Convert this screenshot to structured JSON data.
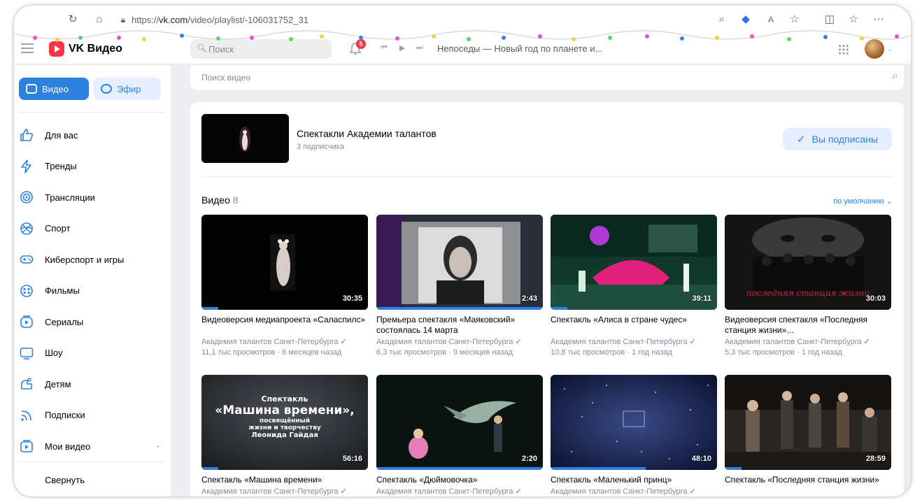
{
  "browser": {
    "url_prefix": "https://",
    "url_domain": "vk.com",
    "url_path": "/video/playlist/-106031752_31"
  },
  "header": {
    "logo": "VK Видео",
    "search_placeholder": "Поиск",
    "notifications_count": "5",
    "now_playing": "Непоседы — Новый год по планете и..."
  },
  "sidebar": {
    "tab_video": "Видео",
    "tab_efir": "Эфир",
    "items": [
      {
        "label": "Для вас",
        "icon": "thumbs-up-icon"
      },
      {
        "label": "Тренды",
        "icon": "lightning-icon"
      },
      {
        "label": "Трансляции",
        "icon": "broadcast-icon"
      },
      {
        "label": "Спорт",
        "icon": "ball-icon"
      },
      {
        "label": "Киберспорт и игры",
        "icon": "gamepad-icon"
      },
      {
        "label": "Фильмы",
        "icon": "film-reel-icon"
      },
      {
        "label": "Сериалы",
        "icon": "series-icon"
      },
      {
        "label": "Шоу",
        "icon": "tv-icon"
      },
      {
        "label": "Детям",
        "icon": "kids-icon"
      },
      {
        "label": "Подписки",
        "icon": "rss-icon"
      },
      {
        "label": "Мои видео",
        "icon": "my-video-icon"
      }
    ],
    "collapse": "Свернуть"
  },
  "main": {
    "video_search_placeholder": "Поиск видео",
    "playlist": {
      "title": "Спектакли Академии талантов",
      "subscribers": "3 подписчика",
      "subscribed_label": "Вы подписаны"
    },
    "section_title": "Видео",
    "section_count": "8",
    "sort_label": "по умолчанию",
    "videos": [
      {
        "title": "Видеоверсия медиапроекта «Саласпилс»",
        "author": "Академия талантов Санкт-Петербурга",
        "meta": "11,1 тыс просмотров · 6 месяцев назад",
        "duration": "30:35",
        "progress": 0.1
      },
      {
        "title": "Премьера спектакля «Маяковский» состоялась 14 марта",
        "author": "Академия талантов Санкт-Петербурга",
        "meta": "6,3 тыс просмотров · 9 месяцев назад",
        "duration": "2:43",
        "progress": 1.0
      },
      {
        "title": "Спектакль «Алиса в стране чудес»",
        "author": "Академия талантов Санкт-Петербурга",
        "meta": "10,8 тыс просмотров · 1 год назад",
        "duration": "39:11",
        "progress": 0.1
      },
      {
        "title": "Видеоверсия спектакля «Последняя станция жизни»...",
        "author": "Академия талантов Санкт-Петербурга",
        "meta": "5,3 тыс просмотров · 1 год назад",
        "duration": "30:03",
        "progress": 0.0,
        "overlay": "последняя станция жизни"
      },
      {
        "title": "Спектакль «Машина времени»",
        "author": "Академия талантов Санкт-Петербурга",
        "meta": "",
        "duration": "56:16",
        "progress": 0.1,
        "overlay_lines": [
          "Спектакль",
          "«Машина времени»,",
          "посвящённый",
          "жизни и творчеству",
          "Леонида Гайдая"
        ]
      },
      {
        "title": "Спектакль «Дюймовочка»",
        "author": "Академия талантов Санкт-Петербурга",
        "meta": "",
        "duration": "2:20",
        "progress": 1.0
      },
      {
        "title": "Спектакль «Маленький принц»",
        "author": "Академия талантов Санкт-Петербурга",
        "meta": "",
        "duration": "48:10",
        "progress": 0.57
      },
      {
        "title": "Спектакль «Последняя станция жизни»",
        "author": "",
        "meta": "",
        "duration": "28:59",
        "progress": 0.1
      }
    ]
  },
  "colors": {
    "accent": "#2d81e0",
    "brand": "#ff3347",
    "accent_light": "#e5efff",
    "text_secondary": "#818c99"
  }
}
